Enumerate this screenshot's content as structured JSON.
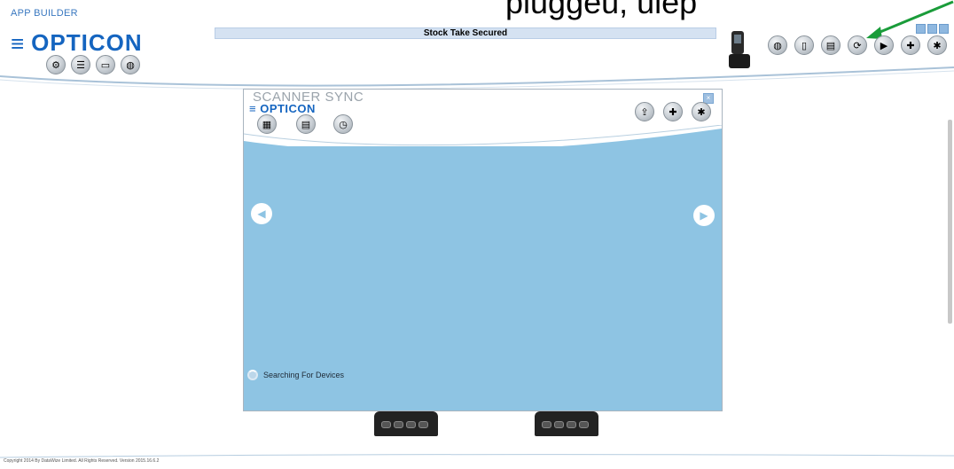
{
  "app": {
    "title": "APP BUILDER",
    "brand": "OPTICON",
    "status_text": "Stock Take Secured",
    "overlay_text": "pluggeu, ulep"
  },
  "window_controls": [
    "minimize",
    "maximize",
    "close"
  ],
  "top_left_toolbar": [
    {
      "icon": "settings-icon"
    },
    {
      "icon": "list-icon"
    },
    {
      "icon": "folder-icon"
    },
    {
      "icon": "globe-icon"
    }
  ],
  "top_right_toolbar": [
    {
      "icon": "device-icon"
    },
    {
      "icon": "earth-icon"
    },
    {
      "icon": "phone-icon"
    },
    {
      "icon": "docs-icon"
    },
    {
      "icon": "sync-icon"
    },
    {
      "icon": "play-icon"
    },
    {
      "icon": "help-icon"
    },
    {
      "icon": "uk-flag-icon"
    }
  ],
  "modal": {
    "title": "SCANNER SYNC",
    "brand": "OPTICON",
    "toolbar_left": [
      {
        "icon": "import-icon"
      },
      {
        "icon": "list-icon"
      },
      {
        "icon": "history-icon"
      }
    ],
    "toolbar_right": [
      {
        "icon": "upload-icon"
      },
      {
        "icon": "help-icon"
      },
      {
        "icon": "uk-flag-icon"
      }
    ],
    "searching_text": "Searching For Devices"
  },
  "footer": {
    "copyright": "Copyright 2014 By DataWize Limited. All Rights Reserved. Version 2015.16.6.2"
  }
}
